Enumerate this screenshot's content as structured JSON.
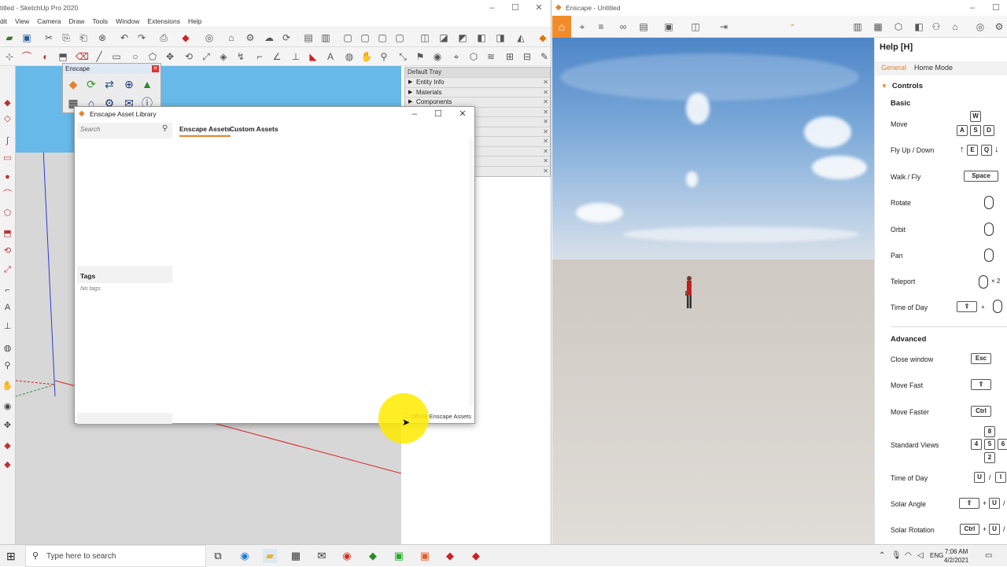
{
  "sketchup": {
    "title": "titled - SketchUp Pro 2020",
    "menu": [
      "dit",
      "View",
      "Camera",
      "Draw",
      "Tools",
      "Window",
      "Extensions",
      "Help"
    ],
    "tray": {
      "title": "Default Tray",
      "items": [
        "Entity Info",
        "Materials",
        "Components"
      ]
    }
  },
  "enscape_toolbar": {
    "title": "Enscape"
  },
  "asset_library": {
    "title": "Enscape Asset Library",
    "search_placeholder": "Search",
    "tabs": [
      "Enscape Assets",
      "Custom Assets"
    ],
    "active_tab": "Enscape Assets",
    "tags_heading": "Tags",
    "no_tags": "No tags",
    "offline_label": "Offline Enscape Assets"
  },
  "enscape": {
    "title": "Enscape - Untitled",
    "help": {
      "title": "Help [H]",
      "tabs": [
        "General",
        "Home Mode"
      ],
      "controls_heading": "Controls",
      "basic_heading": "Basic",
      "advanced_heading": "Advanced",
      "basic": [
        {
          "label": "Move",
          "keys": [
            "W",
            "A",
            "S",
            "D"
          ]
        },
        {
          "label": "Fly Up / Down",
          "keys": [
            "E",
            "Q"
          ]
        },
        {
          "label": "Walk / Fly",
          "keys": [
            "Space"
          ]
        },
        {
          "label": "Rotate",
          "keys": []
        },
        {
          "label": "Orbit",
          "keys": []
        },
        {
          "label": "Pan",
          "keys": []
        },
        {
          "label": "Teleport",
          "keys": [
            "× 2"
          ]
        },
        {
          "label": "Time of Day",
          "keys": [
            "+"
          ]
        }
      ],
      "advanced": [
        {
          "label": "Close window",
          "keys": [
            "Esc"
          ]
        },
        {
          "label": "Move Fast",
          "keys": []
        },
        {
          "label": "Move Faster",
          "keys": [
            "Ctrl"
          ]
        },
        {
          "label": "Standard Views",
          "keys": [
            "8",
            "4",
            "5",
            "6",
            "2"
          ]
        },
        {
          "label": "Time of Day",
          "keys": [
            "U",
            "/",
            "I"
          ]
        },
        {
          "label": "Solar Angle",
          "keys": [
            "+",
            "U",
            "/"
          ]
        },
        {
          "label": "Solar Rotation",
          "keys": [
            "Ctrl",
            "+",
            "U",
            "/"
          ]
        }
      ]
    }
  },
  "taskbar": {
    "search_placeholder": "Type here to search",
    "language": "ENG",
    "time": "7:06 AM",
    "date": "4/2/2021"
  },
  "colors": {
    "accent": "#e8822a",
    "sketchup_sky": "#66b9e8",
    "highlight": "#ffeb00"
  }
}
